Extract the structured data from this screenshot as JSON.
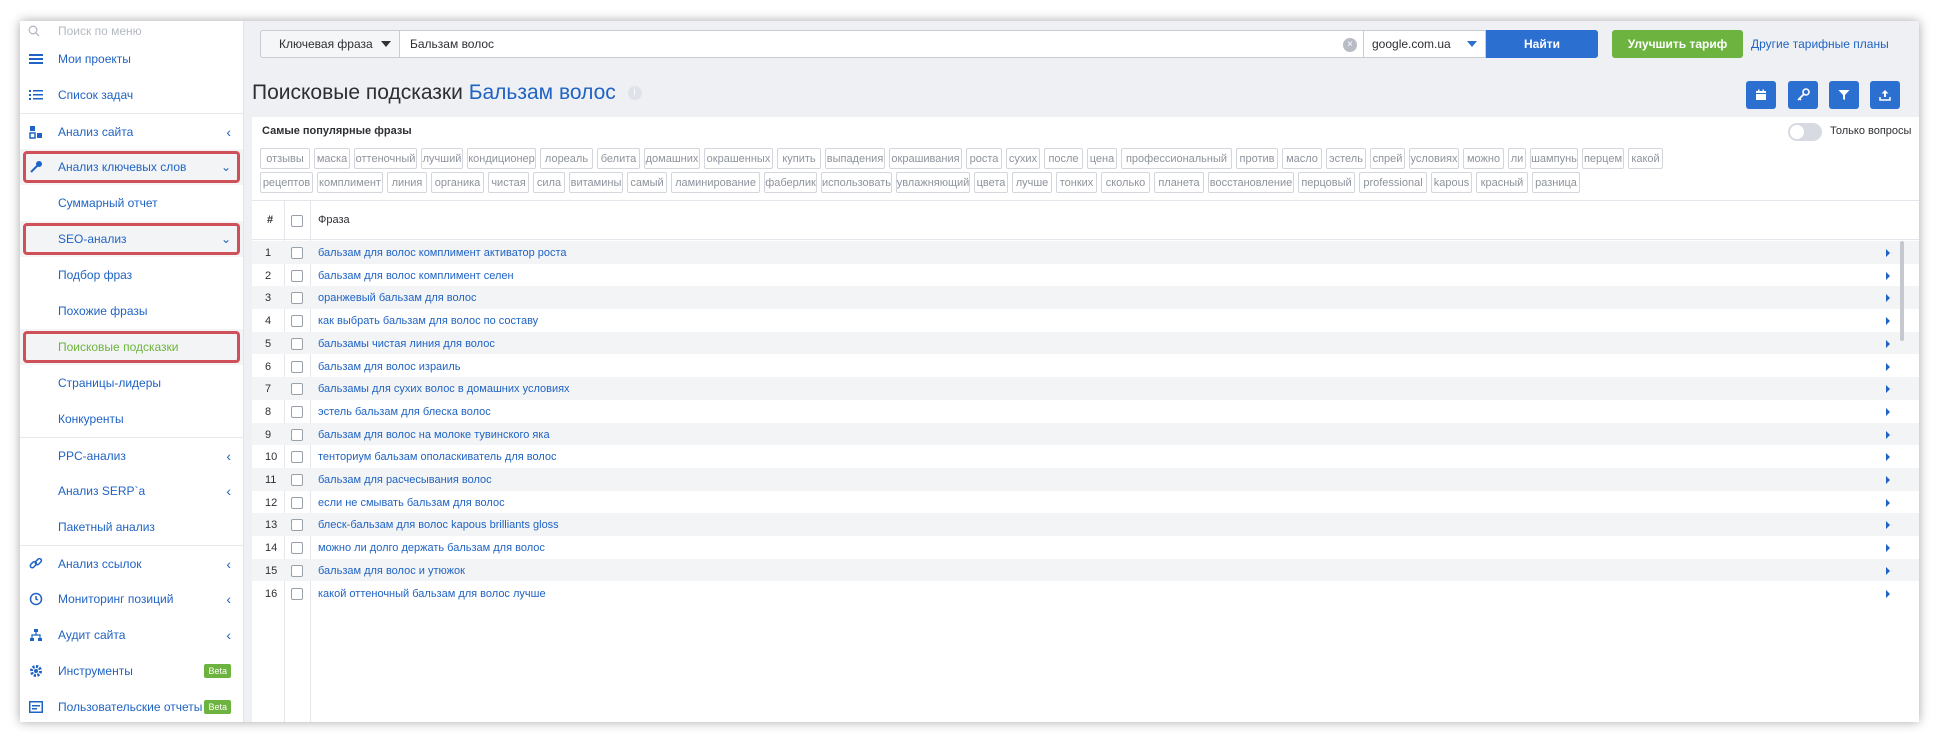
{
  "sidebar": {
    "search_placeholder": "Поиск по меню",
    "items": [
      {
        "label": "Мои проекты"
      },
      {
        "label": "Список задач"
      },
      {
        "label": "Анализ сайта"
      },
      {
        "label": "Анализ ключевых слов"
      },
      {
        "label": "Суммарный отчет"
      },
      {
        "label": "SEO-анализ"
      },
      {
        "label": "Подбор фраз"
      },
      {
        "label": "Похожие фразы"
      },
      {
        "label": "Поисковые подсказки"
      },
      {
        "label": "Страницы-лидеры"
      },
      {
        "label": "Конкуренты"
      },
      {
        "label": "PPC-анализ"
      },
      {
        "label": "Анализ SERP`a"
      },
      {
        "label": "Пакетный анализ"
      },
      {
        "label": "Анализ ссылок"
      },
      {
        "label": "Мониторинг позиций"
      },
      {
        "label": "Аудит сайта"
      },
      {
        "label": "Инструменты"
      },
      {
        "label": "Пользовательские отчеты"
      }
    ],
    "beta_label": "Beta"
  },
  "topbar": {
    "type_select": "Ключевая фраза",
    "query": "Бальзам волос",
    "engine": "google.com.ua",
    "find_label": "Найти",
    "upgrade_label": "Улучшить тариф",
    "plans_label": "Другие тарифные планы"
  },
  "page": {
    "title_prefix": "Поисковые подсказки",
    "title_keyword": "Бальзам волос"
  },
  "popular": {
    "title": "Самые популярные фразы",
    "only_questions": "Только вопросы",
    "tags_row1": [
      "отзывы",
      "маска",
      "оттеночный",
      "лучший",
      "кондиционер",
      "лореаль",
      "белита",
      "домашних",
      "окрашенных",
      "купить",
      "выпадения",
      "окрашивания",
      "роста",
      "сухих",
      "после",
      "цена",
      "профессиональный",
      "против",
      "масло",
      "эстель",
      "спрей",
      "условиях",
      "можно",
      "ли",
      "шампунь",
      "перцем",
      "какой"
    ],
    "tags_row2": [
      "рецептов",
      "комплимент",
      "линия",
      "органика",
      "чистая",
      "сила",
      "витамины",
      "самый",
      "ламинирование",
      "фаберлик",
      "использовать",
      "увлажняющий",
      "цвета",
      "лучше",
      "тонких",
      "сколько",
      "планета",
      "восстановление",
      "перцовый",
      "professional",
      "kapous",
      "красный",
      "разница"
    ]
  },
  "table": {
    "col_num": "#",
    "col_phrase": "Фраза",
    "rows": [
      {
        "n": "1",
        "phrase": "бальзам для волос комплимент активатор роста"
      },
      {
        "n": "2",
        "phrase": "бальзам для волос комплимент селен"
      },
      {
        "n": "3",
        "phrase": "оранжевый бальзам для волос"
      },
      {
        "n": "4",
        "phrase": "как выбрать бальзам для волос по составу"
      },
      {
        "n": "5",
        "phrase": "бальзамы чистая линия для волос"
      },
      {
        "n": "6",
        "phrase": "бальзам для волос израиль"
      },
      {
        "n": "7",
        "phrase": "бальзамы для сухих волос в домашних условиях"
      },
      {
        "n": "8",
        "phrase": "эстель бальзам для блеска волос"
      },
      {
        "n": "9",
        "phrase": "бальзам для волос на молоке тувинского яка"
      },
      {
        "n": "10",
        "phrase": "тенториум бальзам ополаскиватель для волос"
      },
      {
        "n": "11",
        "phrase": "бальзам для расчесывания волос"
      },
      {
        "n": "12",
        "phrase": "если не смывать бальзам для волос"
      },
      {
        "n": "13",
        "phrase": "блеск-бальзам для волос kapous brilliants gloss"
      },
      {
        "n": "14",
        "phrase": "можно ли долго держать бальзам для волос"
      },
      {
        "n": "15",
        "phrase": "бальзам для волос и утюжок"
      },
      {
        "n": "16",
        "phrase": "какой оттеночный бальзам для волос лучше"
      }
    ]
  },
  "colors": {
    "primary": "#2b6fd0",
    "green": "#6db33f",
    "highlight": "#d0505a"
  }
}
